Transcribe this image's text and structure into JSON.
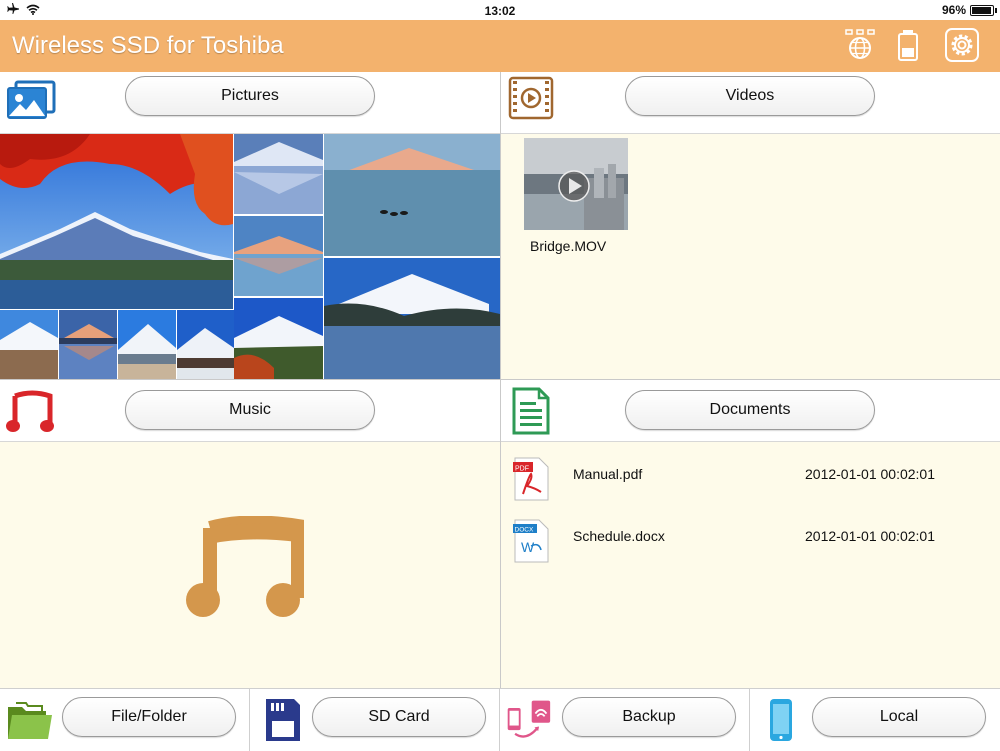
{
  "status_bar": {
    "time": "13:02",
    "battery_text": "96%",
    "battery_level": 0.96,
    "icons": [
      "airplane-mode-icon",
      "wifi-icon",
      "battery-icon"
    ]
  },
  "header": {
    "title": "Wireless SSD for Toshiba",
    "color": "#f3b26d",
    "icons": [
      "network-globe-icon",
      "ssd-battery-icon",
      "settings-gear-icon"
    ]
  },
  "panels": {
    "pictures": {
      "label": "Pictures",
      "icon": "pictures-icon"
    },
    "videos": {
      "label": "Videos",
      "icon": "videos-icon",
      "items": [
        {
          "name": "Bridge.MOV",
          "icon": "play-icon"
        }
      ]
    },
    "music": {
      "label": "Music",
      "icon": "music-note-icon",
      "placeholder_icon": "music-note-icon"
    },
    "documents": {
      "label": "Documents",
      "icon": "document-icon",
      "items": [
        {
          "name": "Manual.pdf",
          "date": "2012-01-01 00:02:01",
          "icon": "pdf-file-icon",
          "badge": "PDF"
        },
        {
          "name": "Schedule.docx",
          "date": "2012-01-01 00:02:01",
          "icon": "docx-file-icon",
          "badge": "DOCX"
        }
      ]
    }
  },
  "bottom_bar": {
    "items": [
      {
        "label": "File/Folder",
        "icon": "folder-icon"
      },
      {
        "label": "SD Card",
        "icon": "sd-card-icon"
      },
      {
        "label": "Backup",
        "icon": "backup-icon"
      },
      {
        "label": "Local",
        "icon": "phone-icon"
      }
    ]
  },
  "colors": {
    "accent": "#f3b26d",
    "panel_background": "#fefbea",
    "music_icon": "#d4974c",
    "music_header_icon": "#d9262a",
    "doc_header_icon": "#2e9a55"
  }
}
